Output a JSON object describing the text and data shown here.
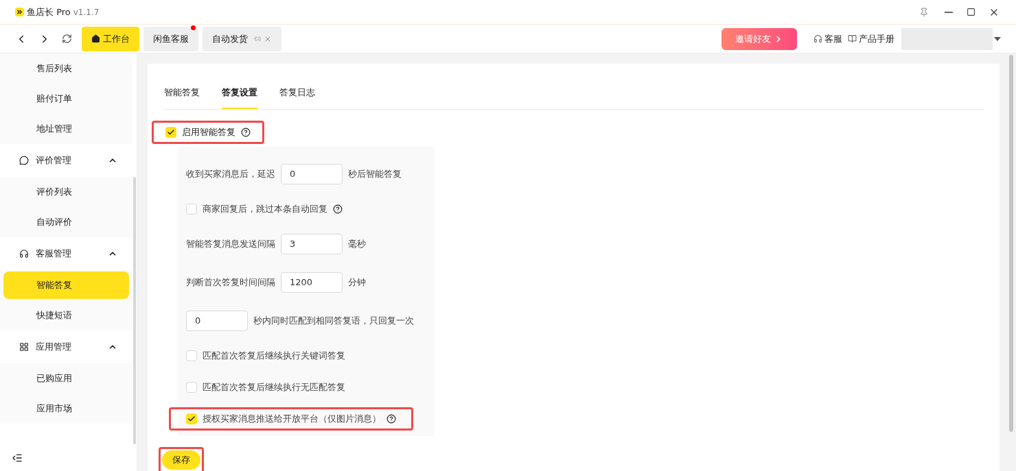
{
  "window": {
    "app_name": "鱼店长 Pro",
    "version": "v1.1.7"
  },
  "nav_tabs": [
    {
      "label": "工作台",
      "selected": true,
      "kind": "home",
      "badge": false,
      "closable": false
    },
    {
      "label": "闲鱼客服",
      "selected": false,
      "kind": "plain",
      "badge": true,
      "closable": false
    },
    {
      "label": "自动发货",
      "selected": false,
      "kind": "plain",
      "badge": false,
      "closable": true
    }
  ],
  "invite_button": "邀请好友",
  "header_links": [
    {
      "label": "客服",
      "kind": "headset"
    },
    {
      "label": "产品手册",
      "kind": "book"
    }
  ],
  "sidebar": {
    "items": [
      {
        "label": "售后列表",
        "kind": "child",
        "selected": false
      },
      {
        "label": "赔付订单",
        "kind": "child",
        "selected": false
      },
      {
        "label": "地址管理",
        "kind": "child",
        "selected": false
      },
      {
        "label": "评价管理",
        "kind": "group",
        "expanded": true
      },
      {
        "label": "评价列表",
        "kind": "child",
        "selected": false
      },
      {
        "label": "自动评价",
        "kind": "child",
        "selected": false
      },
      {
        "label": "客服管理",
        "kind": "group",
        "expanded": true
      },
      {
        "label": "智能答复",
        "kind": "child",
        "selected": true
      },
      {
        "label": "快捷短语",
        "kind": "child",
        "selected": false
      },
      {
        "label": "应用管理",
        "kind": "group",
        "expanded": true
      },
      {
        "label": "已购应用",
        "kind": "child",
        "selected": false
      },
      {
        "label": "应用市场",
        "kind": "child",
        "selected": false
      }
    ]
  },
  "content_tabs": [
    {
      "label": "智能答复",
      "selected": false
    },
    {
      "label": "答复设置",
      "selected": true
    },
    {
      "label": "答复日志",
      "selected": false
    }
  ],
  "enable": {
    "label": "启用智能答复",
    "checked": true,
    "help": true,
    "highlighted": true
  },
  "settings": [
    {
      "kind": "input_after",
      "label": "收到买家消息后，延迟",
      "value": "0",
      "suffix": "秒后智能答复"
    },
    {
      "kind": "checkbox",
      "label": "商家回复后，跳过本条自动回复",
      "checked": false,
      "help": true,
      "highlighted": false
    },
    {
      "kind": "input_after",
      "label": "智能答复消息发送间隔",
      "value": "3",
      "suffix": "毫秒"
    },
    {
      "kind": "input_after",
      "label": "判断首次答复时间间隔",
      "value": "1200",
      "suffix": "分钟"
    },
    {
      "kind": "input_before",
      "value": "0",
      "suffix": "秒内同时匹配到相同答复语，只回复一次"
    },
    {
      "kind": "checkbox",
      "label": "匹配首次答复后继续执行关键词答复",
      "checked": false,
      "help": false,
      "highlighted": false
    },
    {
      "kind": "checkbox",
      "label": "匹配首次答复后继续执行无匹配答复",
      "checked": false,
      "help": false,
      "highlighted": false
    },
    {
      "kind": "checkbox",
      "label": "授权买家消息推送给开放平台（仅图片消息）",
      "checked": true,
      "help": true,
      "highlighted": true
    }
  ],
  "save_button": {
    "label": "保存",
    "highlighted": true
  }
}
